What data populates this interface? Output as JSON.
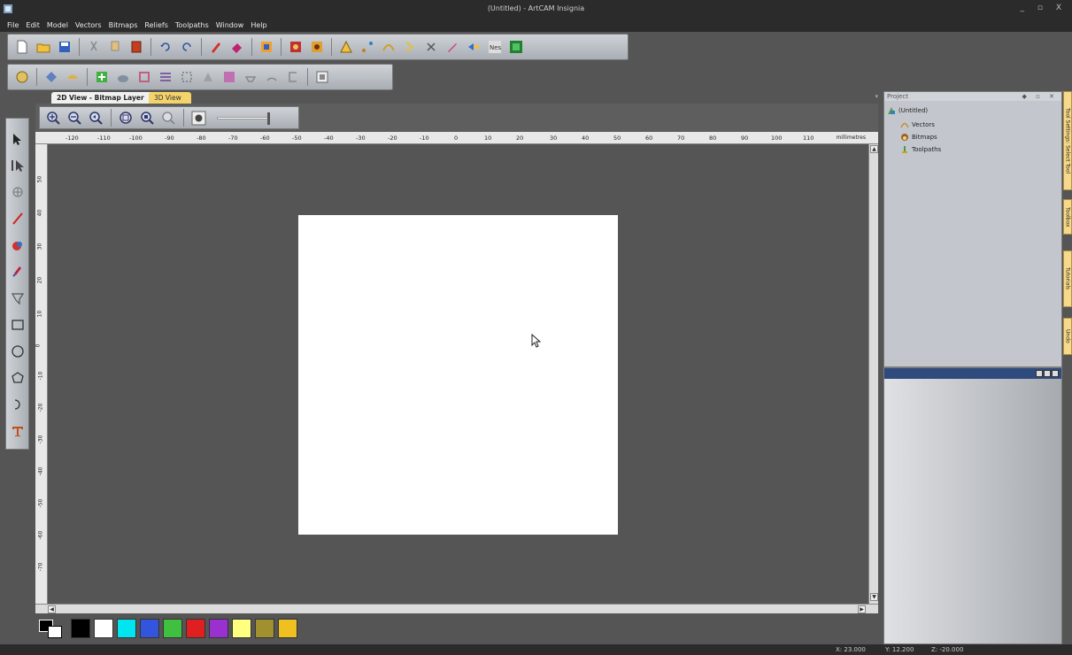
{
  "window": {
    "title": "(Untitled) - ArtCAM Insignia",
    "controls": "_ ▫ X"
  },
  "menu": [
    "File",
    "Edit",
    "Model",
    "Vectors",
    "Bitmaps",
    "Reliefs",
    "Toolpaths",
    "Window",
    "Help"
  ],
  "tabs": {
    "view2d": "2D View - Bitmap Layer",
    "view2d_close": "×",
    "view3d": "3D View",
    "dropdown": "▾"
  },
  "ruler": {
    "units": "millimetres",
    "top_labels": [
      "-120",
      "-110",
      "-100",
      "-90",
      "-80",
      "-70",
      "-60",
      "-50",
      "-40",
      "-30",
      "-20",
      "-10",
      "0",
      "10",
      "20",
      "30",
      "40",
      "50",
      "60",
      "70",
      "80",
      "90",
      "100",
      "110"
    ],
    "left_labels": [
      "50",
      "40",
      "30",
      "20",
      "10",
      "0",
      "-10",
      "-20",
      "-30",
      "-40",
      "-50",
      "-60",
      "-70"
    ]
  },
  "project": {
    "header": "Project",
    "header_buttons": "◆ ▫ ✕",
    "root": "(Untitled)",
    "items": [
      "Vectors",
      "Bitmaps",
      "Toolpaths"
    ]
  },
  "side_tabs": [
    "Tool Settings: Select Tool",
    "Toolbox",
    "Tutorials",
    "Undo"
  ],
  "palette": {
    "swatches": [
      "#000000",
      "#ffffff",
      "#00e5f0",
      "#3355dd",
      "#40c040",
      "#e02020",
      "#9a30d0",
      "#ffff80",
      "#a09030",
      "#f0c020"
    ]
  },
  "status": {
    "x": "X: 23.000",
    "y": "Y: 12.200",
    "z": "Z: -20.000"
  },
  "scroll": {
    "up": "▲",
    "down": "▼",
    "left": "◀",
    "right": "▶"
  }
}
